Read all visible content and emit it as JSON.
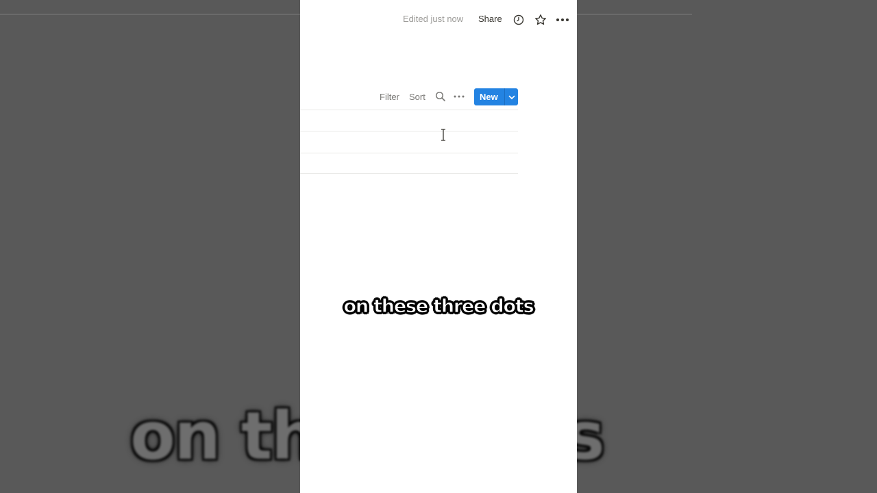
{
  "topbar": {
    "edited_status": "Edited just now",
    "share_label": "Share",
    "history_icon": "clock-icon",
    "favorite_icon": "star-icon",
    "more_icon": "more-horizontal-icon"
  },
  "database_toolbar": {
    "filter_label": "Filter",
    "sort_label": "Sort",
    "search_icon": "search-icon",
    "more_icon": "more-horizontal-icon",
    "new_label": "New",
    "new_dropdown_icon": "chevron-down-icon"
  },
  "caption": {
    "text": "on these three dots",
    "background_text": "on the     e dots"
  },
  "colors": {
    "accent": "#2383e2",
    "muted_text": "#9b9a97",
    "primary_text": "#37352f",
    "page_background": "#ffffff",
    "backdrop": "#595959"
  }
}
